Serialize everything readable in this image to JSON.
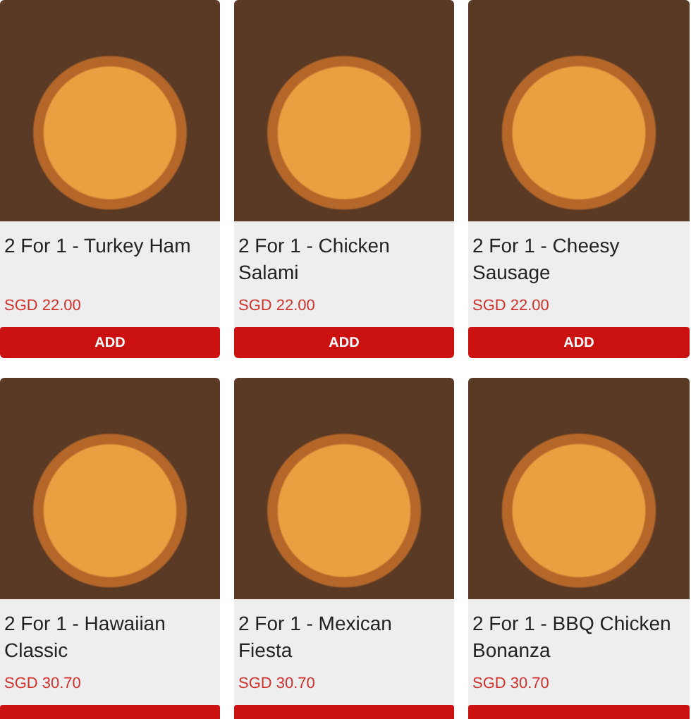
{
  "products": [
    {
      "name": "2 For 1 - Turkey Ham",
      "price": "SGD 22.00",
      "button": "ADD"
    },
    {
      "name": "2 For 1 - Chicken Salami",
      "price": "SGD 22.00",
      "button": "ADD"
    },
    {
      "name": "2 For 1 - Cheesy Sausage",
      "price": "SGD 22.00",
      "button": "ADD"
    },
    {
      "name": "2 For 1 - Hawaiian Classic",
      "price": "SGD 30.70"
    },
    {
      "name": "2 For 1 - Mexican Fiesta",
      "price": "SGD 30.70"
    },
    {
      "name": "2 For 1 - BBQ Chicken Bonanza",
      "price": "SGD 30.70"
    }
  ]
}
